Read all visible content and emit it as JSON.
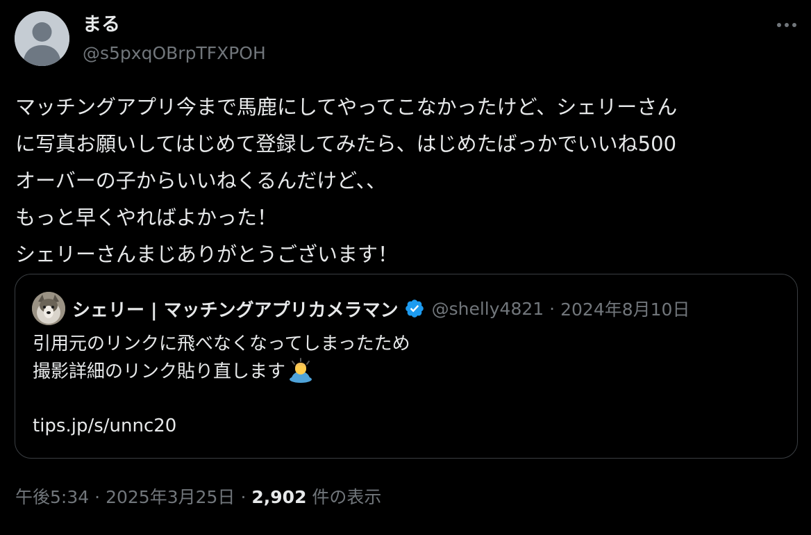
{
  "author": {
    "display_name": "まる",
    "handle": "@s5pxqOBrpTFXPOH",
    "avatar_icon": "default-avatar-icon"
  },
  "more_icon": "more-horizontal-icon",
  "tweet": {
    "lines": [
      "マッチングアプリ今まで馬鹿にしてやってこなかったけど、シェリーさん",
      "に写真お願いしてはじめて登録してみたら、はじめたばっかでいいね500",
      "オーバーの子からいいねくるんだけど、、",
      "もっと早くやればよかった！",
      "シェリーさんまじありがとうございます！"
    ]
  },
  "quote": {
    "display_name": "シェリー | マッチングアプリカメラマン",
    "verified_icon": "verified-badge-icon",
    "handle": "@shelly4821",
    "separator": "·",
    "date": "2024年8月10日",
    "lines": [
      "引用元のリンクに飛べなくなってしまったため",
      "撮影詳細のリンク貼り直します"
    ],
    "emoji_icon": "person-bowing-emoji-icon",
    "link": "tips.jp/s/unnc20"
  },
  "meta": {
    "time": "午後5:34",
    "separator": "·",
    "date": "2025年3月25日",
    "views_count": "2,902",
    "views_label": "件の表示"
  },
  "colors": {
    "background": "#000000",
    "text_primary": "#e7e9ea",
    "text_secondary": "#71767b",
    "border": "#3b3f43",
    "verified_blue": "#1d9bf0"
  }
}
